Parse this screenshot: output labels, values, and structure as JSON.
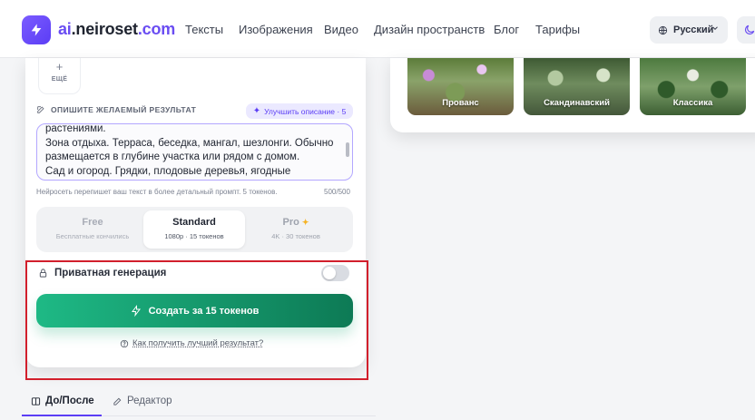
{
  "header": {
    "brand": {
      "part1": "ai",
      "part2": ".neiroset",
      "part3": ".com"
    },
    "nav": [
      "Тексты",
      "Изображения",
      "Видео",
      "Дизайн пространств",
      "Блог",
      "Тарифы"
    ],
    "language": "Русский",
    "icons": {
      "logo": "lightning-icon",
      "language": "globe-icon",
      "dropdown": "chevron-down-icon"
    }
  },
  "form": {
    "more_tile_label": "ЕЩЁ",
    "section_label": "ОПИШИТЕ ЖЕЛАЕМЫЙ РЕЗУЛЬТАТ",
    "improve_label": "Улучшить описание · 5",
    "textarea_value": "растениями.\nЗона отдыха. Терраса, беседка, мангал, шезлонги. Обычно размещается в глубине участка или рядом с домом.\nСад и огород. Грядки, плодовые деревья, ягодные",
    "hint": "Нейросеть перепишет ваш текст в более детальный промпт. 5 токенов.",
    "counter": "500/500",
    "plans": [
      {
        "name": "Free",
        "sub": "Бесплатные кончились"
      },
      {
        "name": "Standard",
        "sub": "1080p · 15 токенов"
      },
      {
        "name": "Pro",
        "sub": "4K · 30 токенов"
      }
    ],
    "private_label": "Приватная генерация",
    "private_enabled": false,
    "create_label": "Создать за 15 токенов",
    "help_label": "Как получить лучший результат?"
  },
  "styles": [
    "Прованс",
    "Скандинавский",
    "Классика"
  ],
  "tabs": {
    "before_after": "До/После",
    "editor": "Редактор"
  },
  "colors": {
    "accent": "#5b3df5",
    "create_button": "#1eb985",
    "highlight_border": "#d21f2c"
  }
}
